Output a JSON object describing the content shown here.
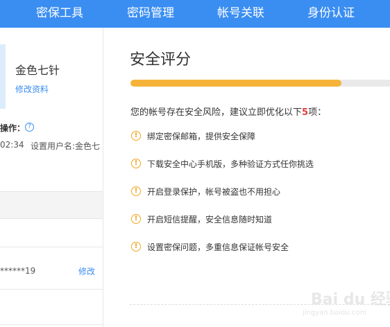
{
  "nav": {
    "items": [
      "密保工具",
      "密码管理",
      "帐号关联",
      "身份认证"
    ]
  },
  "sidebar": {
    "username": "金色七针",
    "edit_profile": "修改资料",
    "recent_label": "操作：",
    "recent_time": "02:34",
    "recent_action": "设置用户名:金色七",
    "phone_masked": "******19",
    "phone_edit": "修改"
  },
  "security": {
    "title": "安全评分",
    "progress": 0.8,
    "risk_prefix": "您的帐号存在安全风险，建议立即优化以下",
    "risk_count": "5",
    "risk_suffix": "项：",
    "tips": [
      "绑定密保邮箱，提供安全保障",
      "下载安全中心手机版，多种验证方式任你挑选",
      "开启登录保护，帐号被盗也不用担心",
      "开启短信提醒，安全信息随时知道",
      "设置密保问题，多重信息保证帐号安全"
    ]
  },
  "watermark": {
    "brand": "Bai du 经验",
    "sub": "jingyan.baidu.com"
  },
  "colors": {
    "nav_bg": "#3a8ef2",
    "progress_fill": "#f5b33a",
    "warning": "#f1a51c",
    "risk_count": "#e23b3b",
    "link": "#3a8ef2"
  },
  "icons": {
    "help": "help-circle-icon",
    "warning": "exclamation-circle-icon"
  }
}
